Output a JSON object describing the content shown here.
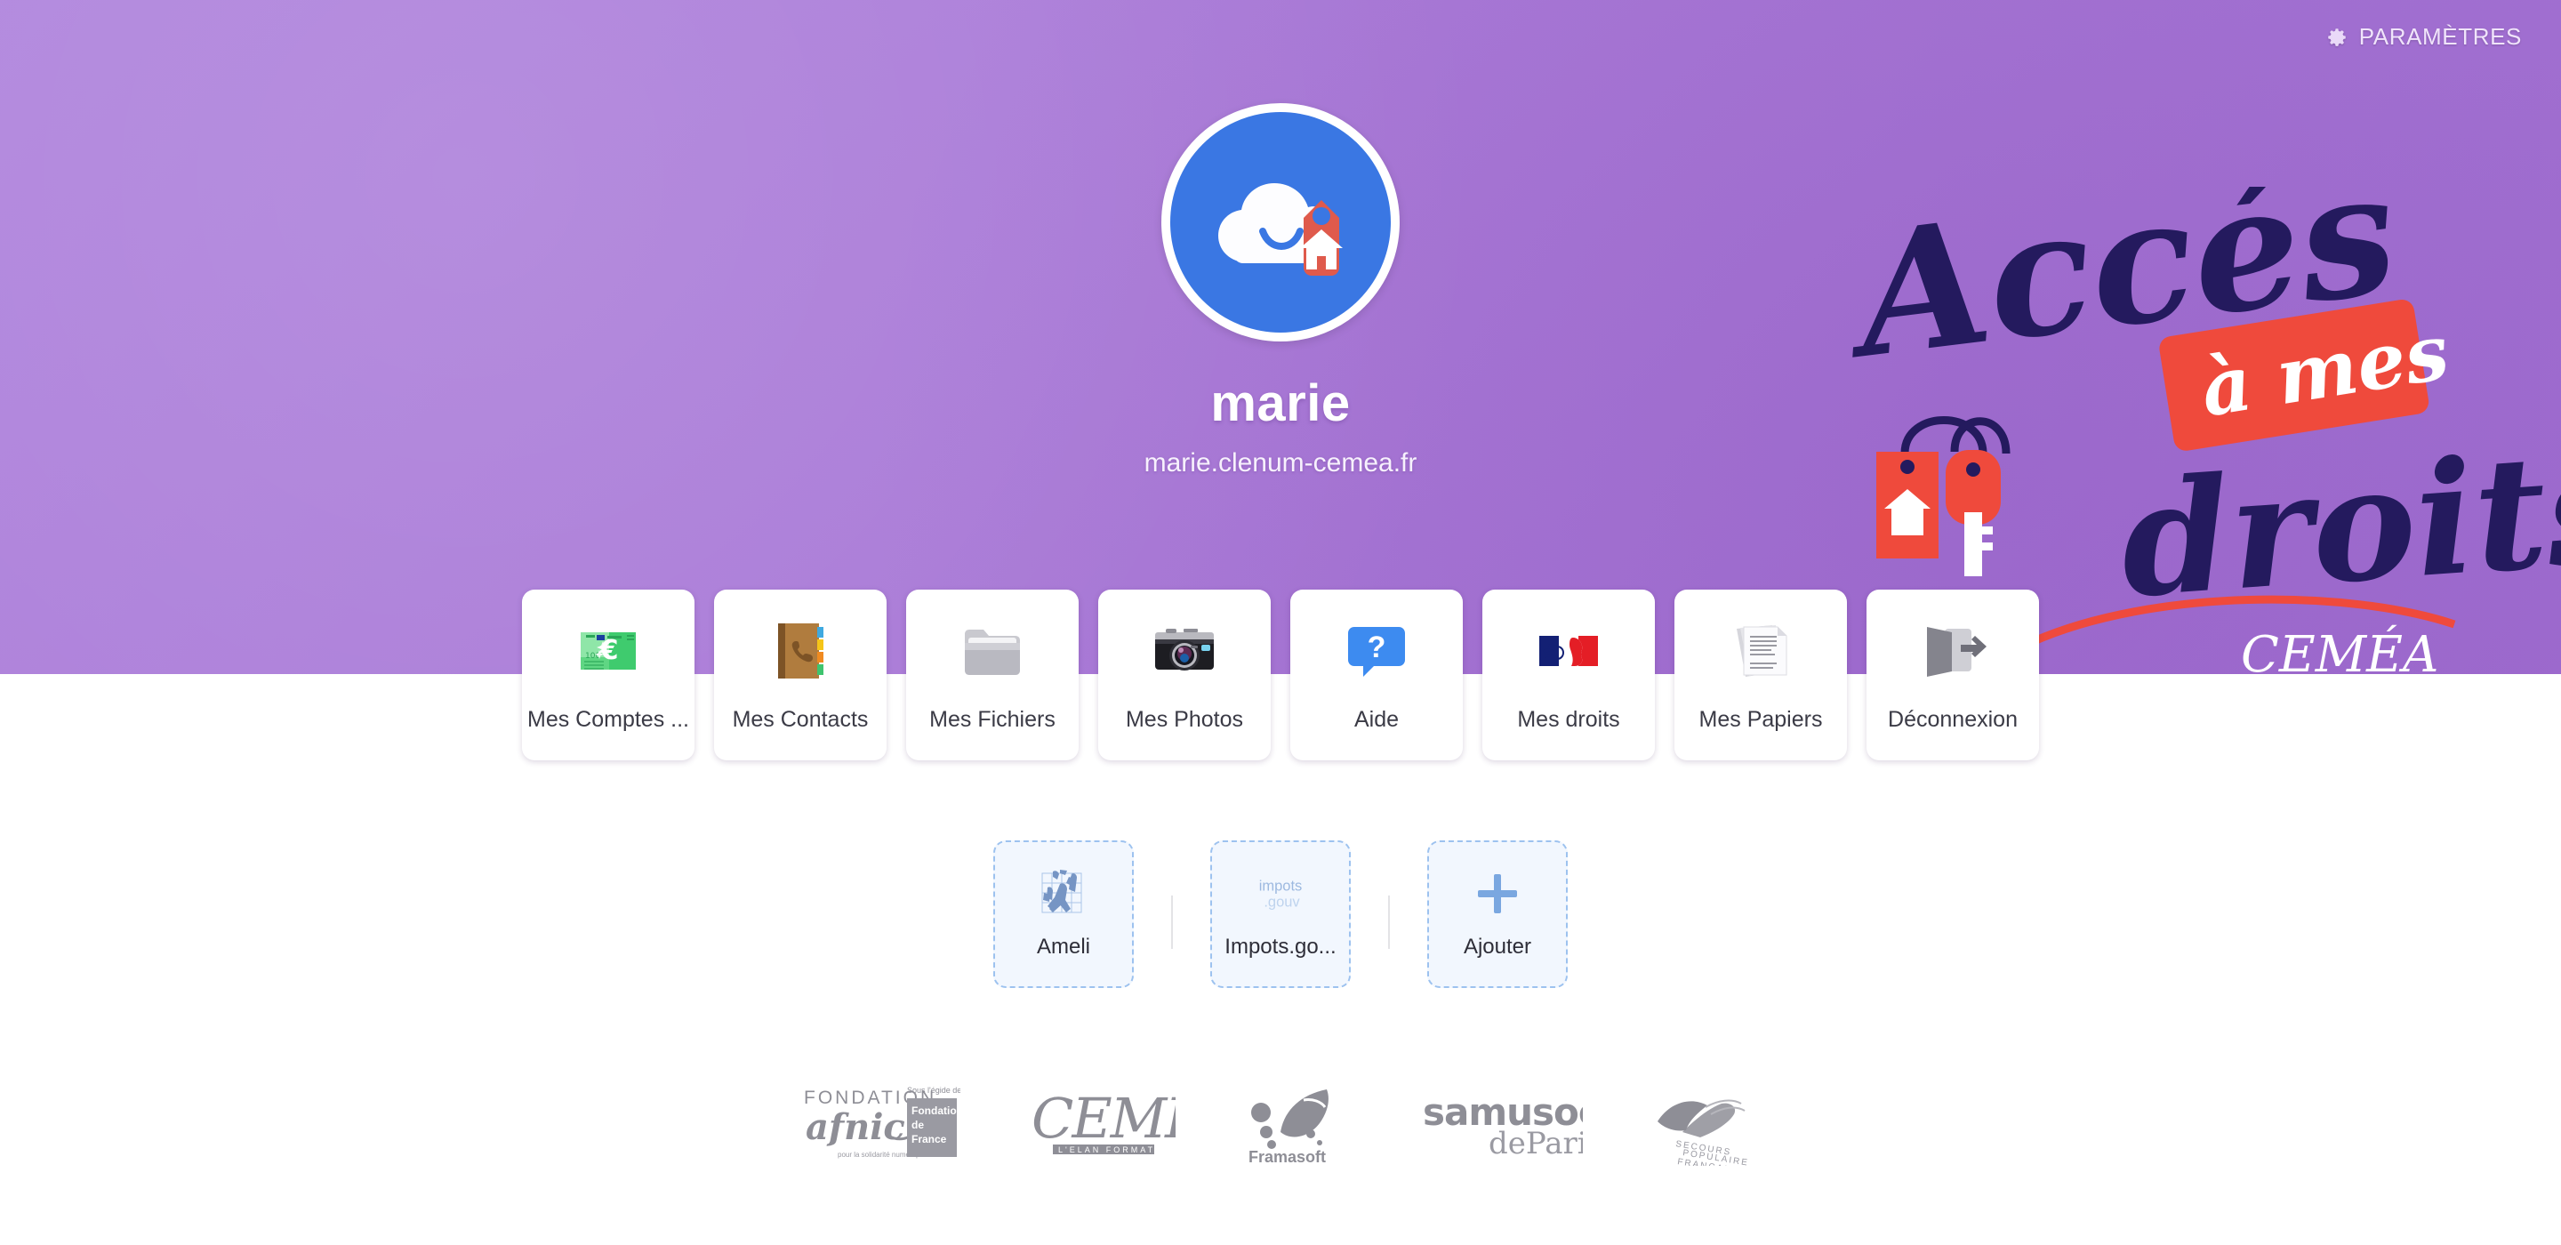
{
  "header": {
    "settings_label": "PARAMÈTRES",
    "settings_icon": "gear-icon"
  },
  "profile": {
    "avatar_icon": "cloud-home-avatar",
    "name": "marie",
    "domain": "marie.clenum-cemea.fr"
  },
  "brand_art": {
    "line1": "Accès",
    "badge": "à mes",
    "line2": "droits",
    "org": "CEMÉA",
    "colors": {
      "ink": "#241a5e",
      "accent": "#ef4a3c",
      "background": "#ab78d8"
    }
  },
  "apps": [
    {
      "label": "Mes Comptes ...",
      "icon": "banknotes-euro-icon"
    },
    {
      "label": "Mes Contacts",
      "icon": "address-book-icon"
    },
    {
      "label": "Mes Fichiers",
      "icon": "folder-icon"
    },
    {
      "label": "Mes Photos",
      "icon": "camera-icon"
    },
    {
      "label": "Aide",
      "icon": "question-bubble-icon"
    },
    {
      "label": "Mes droits",
      "icon": "marianne-flag-icon"
    },
    {
      "label": "Mes Papiers",
      "icon": "documents-icon"
    },
    {
      "label": "Déconnexion",
      "icon": "logout-door-icon"
    }
  ],
  "services": [
    {
      "label": "Ameli",
      "icon": "ameli-logo-icon",
      "logo_text": ""
    },
    {
      "label": "Impots.go...",
      "icon": "impots-logo-icon",
      "logo_text": "impots .gouv"
    },
    {
      "label": "Ajouter",
      "icon": "plus-icon",
      "logo_text": ""
    }
  ],
  "footer_logos": [
    {
      "name": "fondation-afnic-logo",
      "text": "FONDATION afnic — pour la solidarité numérique / Sous l'égide de Fondation de France"
    },
    {
      "name": "cemea-logo",
      "text": "CEMÉA L'ÉLAN FORMATION"
    },
    {
      "name": "framasoft-logo",
      "text": "Framasoft"
    },
    {
      "name": "samusocial-paris-logo",
      "text": "samusocial deParis"
    },
    {
      "name": "secours-populaire-logo",
      "text": "SECOURS POPULAIRE FRANÇAIS"
    }
  ],
  "colors": {
    "hero_purple": "#ab78d8",
    "avatar_blue": "#3a77e3",
    "tag_red": "#ef4a3c",
    "ink_navy": "#241a5e",
    "service_blue": "#9dc2ef",
    "footer_gray": "#9a9aa2"
  }
}
